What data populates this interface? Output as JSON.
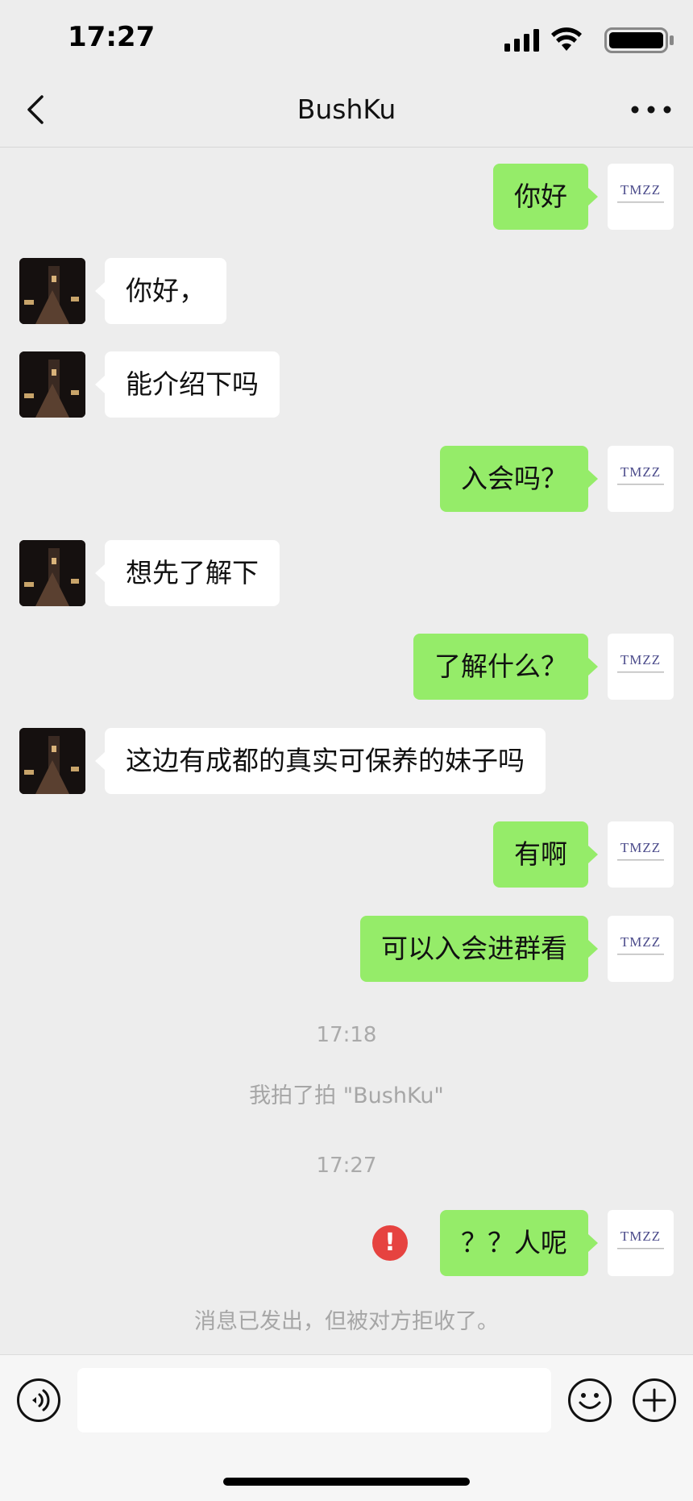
{
  "status_bar": {
    "time": "17:27"
  },
  "header": {
    "title": "BushKu"
  },
  "avatar_logo": {
    "brand": "TMZZ"
  },
  "messages": [
    {
      "from": "me",
      "text": "你好"
    },
    {
      "from": "them",
      "text": "你好，"
    },
    {
      "from": "them",
      "text": "能介绍下吗"
    },
    {
      "from": "me",
      "text": "入会吗？"
    },
    {
      "from": "them",
      "text": "想先了解下"
    },
    {
      "from": "me",
      "text": "了解什么？"
    },
    {
      "from": "them",
      "text": "这边有成都的真实可保养的妹子吗"
    },
    {
      "from": "me",
      "text": "有啊"
    },
    {
      "from": "me",
      "text": "可以入会进群看"
    }
  ],
  "system": {
    "time1": "17:18",
    "pat": "我拍了拍 \"BushKu\"",
    "time2": "17:27",
    "failed_message": "？？人呢",
    "error_mark": "!",
    "rejected_notice": "消息已发出，但被对方拒收了。"
  },
  "colors": {
    "my_bubble": "#95ec69",
    "their_bubble": "#ffffff",
    "background": "#ededed",
    "error": "#e64340"
  },
  "icons": [
    "back-icon",
    "more-icon",
    "voice-icon",
    "emoji-icon",
    "plus-icon",
    "error-icon"
  ]
}
